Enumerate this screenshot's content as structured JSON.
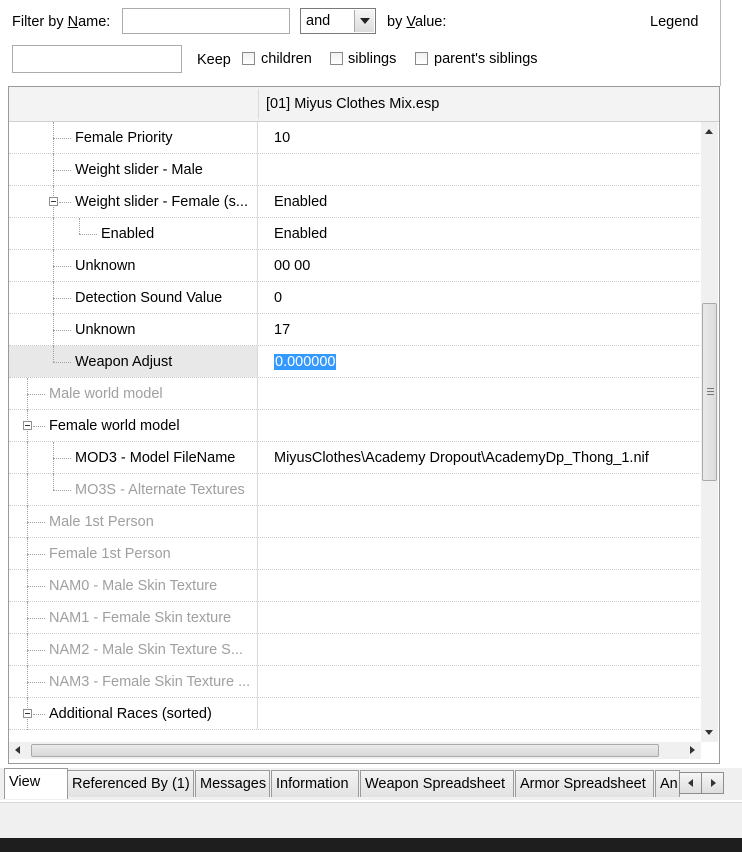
{
  "filter": {
    "name_label": "Filter by Name:",
    "name_label_pre": "Filter by ",
    "name_label_key": "N",
    "name_label_post": "ame:",
    "name_value": "",
    "operator": "and",
    "value_label_pre": "by ",
    "value_label_key": "V",
    "value_label_post": "alue:",
    "legend": "Legend",
    "second_value": "",
    "keep_label": "Keep",
    "children": "children",
    "siblings": "siblings",
    "parents_siblings": "parent's siblings"
  },
  "tree": {
    "column_header": "[01] Miyus Clothes Mix.esp",
    "rows": [
      {
        "name": "Female Priority",
        "value": "10"
      },
      {
        "name": "Weight slider - Male",
        "value": ""
      },
      {
        "name": "Weight slider - Female (s...",
        "value": "Enabled"
      },
      {
        "name": "Enabled",
        "value": "Enabled"
      },
      {
        "name": "Unknown",
        "value": "00 00"
      },
      {
        "name": "Detection Sound Value",
        "value": "0"
      },
      {
        "name": "Unknown",
        "value": "17"
      },
      {
        "name": "Weapon Adjust",
        "value": "0.000000"
      },
      {
        "name": "Male world model",
        "value": ""
      },
      {
        "name": "Female world model",
        "value": ""
      },
      {
        "name": "MOD3 - Model FileName",
        "value": "MiyusClothes\\Academy Dropout\\AcademyDp_Thong_1.nif"
      },
      {
        "name": "MO3S - Alternate Textures",
        "value": ""
      },
      {
        "name": "Male 1st Person",
        "value": ""
      },
      {
        "name": "Female 1st Person",
        "value": ""
      },
      {
        "name": "NAM0 - Male Skin Texture",
        "value": ""
      },
      {
        "name": "NAM1 - Female Skin texture",
        "value": ""
      },
      {
        "name": "NAM2 - Male Skin Texture S...",
        "value": ""
      },
      {
        "name": "NAM3 - Female Skin Texture ...",
        "value": ""
      },
      {
        "name": "Additional Races (sorted)",
        "value": ""
      }
    ]
  },
  "tabs": [
    {
      "label": "View"
    },
    {
      "label": "Referenced By (1)"
    },
    {
      "label": "Messages"
    },
    {
      "label": "Information"
    },
    {
      "label": "Weapon Spreadsheet"
    },
    {
      "label": "Armor Spreadsheet"
    },
    {
      "label": "An"
    }
  ],
  "colors": {
    "selection": "#3399ff",
    "disabled_text": "#a0a0a0",
    "header_bg": "#f3f3f3"
  }
}
